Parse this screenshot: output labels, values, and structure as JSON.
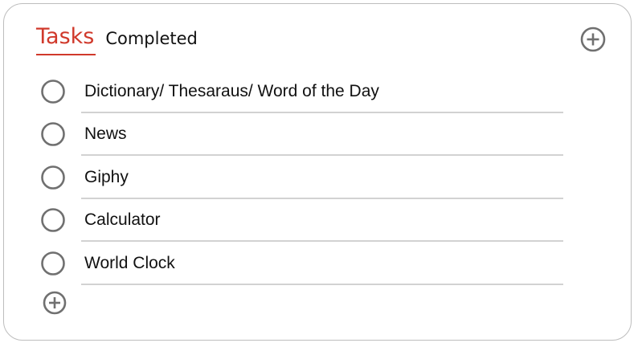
{
  "tabs": {
    "tasks_label": "Tasks",
    "completed_label": "Completed"
  },
  "tasks": [
    {
      "label": "Dictionary/ Thesaraus/ Word of the Day"
    },
    {
      "label": "News"
    },
    {
      "label": "Giphy"
    },
    {
      "label": "Calculator"
    },
    {
      "label": "World Clock"
    }
  ],
  "icons": {
    "add_top": "plus-circle-icon",
    "add_bottom": "plus-circle-icon",
    "task_checkbox": "empty-circle-icon"
  },
  "colors": {
    "accent": "#d0392b",
    "icon_gray": "#707070",
    "divider": "#d2d2d2"
  }
}
